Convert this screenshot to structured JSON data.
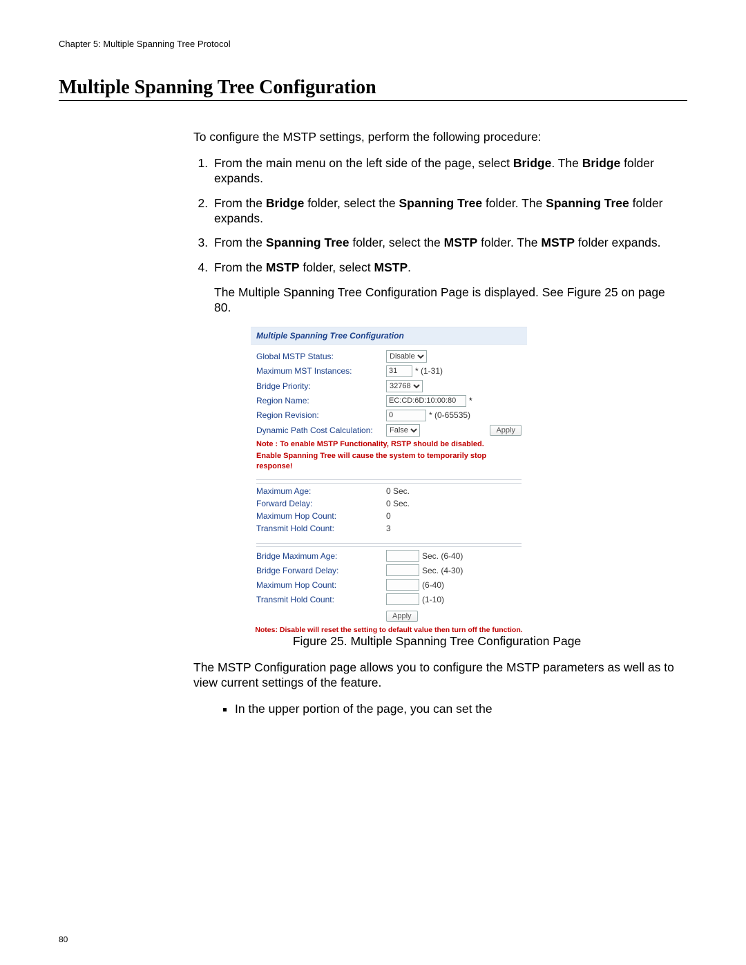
{
  "chapter": "Chapter 5: Multiple Spanning Tree Protocol",
  "section_title": "Multiple Spanning Tree Configuration",
  "intro": "To configure the MSTP settings, perform the following procedure:",
  "steps": {
    "s1a": "From the main menu on the left side of the page, select ",
    "s1b": "Bridge",
    "s1c": ". The ",
    "s1d": "Bridge",
    "s1e": " folder expands.",
    "s2a": "From the ",
    "s2b": "Bridge",
    "s2c": " folder, select the ",
    "s2d": "Spanning Tree",
    "s2e": " folder. The ",
    "s2f": "Spanning Tree",
    "s2g": " folder expands.",
    "s3a": "From the ",
    "s3b": "Spanning Tree",
    "s3c": " folder, select the ",
    "s3d": "MSTP",
    "s3e": " folder. The ",
    "s3f": "MSTP",
    "s3g": " folder expands.",
    "s4a": "From the ",
    "s4b": "MSTP",
    "s4c": " folder, select ",
    "s4d": "MSTP",
    "s4e": "."
  },
  "after_step4": "The Multiple Spanning Tree Configuration Page is displayed. See Figure 25 on page 80.",
  "figure_caption": "Figure 25. Multiple Spanning Tree Configuration Page",
  "post1": "The MSTP Configuration page allows you to configure the MSTP parameters as well as to view current settings of the feature.",
  "post2": "In the upper portion of the page, you can set the",
  "page_number": "80",
  "panel": {
    "title": "Multiple Spanning Tree Configuration",
    "top": {
      "global_mstp_status": {
        "label": "Global MSTP Status:",
        "value": "Disable"
      },
      "max_inst": {
        "label": "Maximum MST Instances:",
        "value": "31",
        "hint": "* (1-31)"
      },
      "bridge_priority": {
        "label": "Bridge Priority:",
        "value": "32768"
      },
      "region_name": {
        "label": "Region Name:",
        "value": "EC:CD:6D:10:00:80",
        "asterisk": "*"
      },
      "region_rev": {
        "label": "Region Revision:",
        "value": "0",
        "hint": "* (0-65535)"
      },
      "dyn_path": {
        "label": "Dynamic Path Cost Calculation:",
        "value": "False"
      },
      "apply": "Apply",
      "note1": "Note : To enable MSTP Functionality, RSTP should be disabled.",
      "note2": "Enable Spanning Tree will cause the system to temporarily stop response!"
    },
    "mid": {
      "max_age": {
        "label": "Maximum Age:",
        "value": "0 Sec."
      },
      "fwd_delay": {
        "label": "Forward Delay:",
        "value": "0 Sec."
      },
      "max_hop": {
        "label": "Maximum Hop Count:",
        "value": "0"
      },
      "tx_hold": {
        "label": "Transmit Hold Count:",
        "value": "3"
      }
    },
    "bottom": {
      "b_max_age": {
        "label": "Bridge Maximum Age:",
        "hint": "Sec. (6-40)"
      },
      "b_fwd_delay": {
        "label": "Bridge Forward Delay:",
        "hint": "Sec. (4-30)"
      },
      "b_max_hop": {
        "label": "Maximum Hop Count:",
        "hint": "(6-40)"
      },
      "b_tx_hold": {
        "label": "Transmit Hold Count:",
        "hint": "(1-10)"
      },
      "apply": "Apply",
      "notes": "Notes: Disable will reset the setting to default value then turn off the function."
    }
  }
}
